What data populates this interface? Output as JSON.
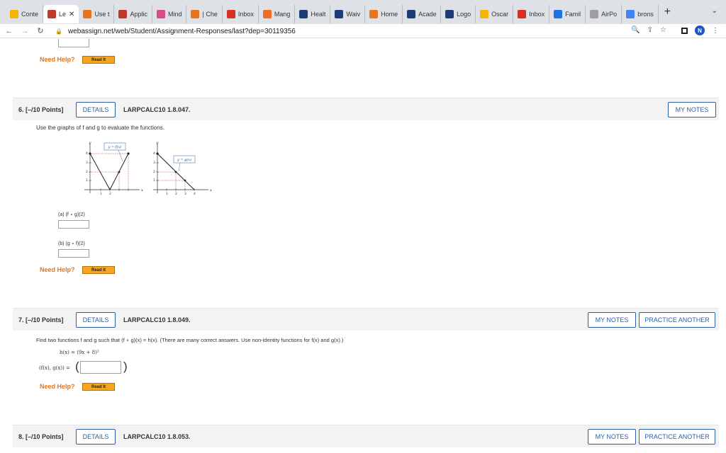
{
  "tabs": [
    {
      "label": "Conte",
      "color": "#f4b400"
    },
    {
      "label": "Le",
      "color": "#c0392b",
      "active": true
    },
    {
      "label": "Use t",
      "color": "#e8741d"
    },
    {
      "label": "Applic",
      "color": "#c0392b"
    },
    {
      "label": "Mind",
      "color": "#d94c8a"
    },
    {
      "label": "| Che",
      "color": "#e8741d"
    },
    {
      "label": "Inbox",
      "color": "#d93025"
    },
    {
      "label": "Mang",
      "color": "#f06b24"
    },
    {
      "label": "Healt",
      "color": "#1c3c7a"
    },
    {
      "label": "Waiv",
      "color": "#1c3c7a"
    },
    {
      "label": "Home",
      "color": "#e8741d"
    },
    {
      "label": "Acade",
      "color": "#1c3c7a"
    },
    {
      "label": "Logo",
      "color": "#1c3c7a"
    },
    {
      "label": "Oscar",
      "color": "#f4b400"
    },
    {
      "label": "Inbox",
      "color": "#d93025"
    },
    {
      "label": "Famil",
      "color": "#1a73e8"
    },
    {
      "label": "AirPo",
      "color": "#9e9e9e"
    },
    {
      "label": "brons",
      "color": "#4285f4"
    }
  ],
  "browser": {
    "url": "webassign.net/web/Student/Assignment-Responses/last?dep=30119356",
    "avatar_letter": "N"
  },
  "help": {
    "need_help": "Need Help?",
    "read_it": "Read It"
  },
  "q6": {
    "number": "6.  [–/10 Points]",
    "details": "DETAILS",
    "code": "LARPCALC10 1.8.047.",
    "my_notes": "MY NOTES",
    "prompt": "Use the graphs of f and g to evaluate the functions.",
    "part_a": "(a)    (f ∘ g)(2)",
    "part_b": "(b)    (g ∘ f)(2)",
    "graph_f_label": "y = f(x)",
    "graph_g_label": "y = g(x)"
  },
  "q7": {
    "number": "7.  [–/10 Points]",
    "details": "DETAILS",
    "code": "LARPCALC10 1.8.049.",
    "my_notes": "MY NOTES",
    "practice": "PRACTICE ANOTHER",
    "prompt": "Find two functions f and g such that (f ∘ g)(x) = h(x). (There are many correct answers. Use non-identity functions for f(x) and g(x).)",
    "h_def": "h(x) = (9x + 8)²",
    "answer_label": "(f(x), g(x)) ="
  },
  "q8": {
    "number": "8.  [–/10 Points]",
    "details": "DETAILS",
    "code": "LARPCALC10 1.8.053.",
    "my_notes": "MY NOTES",
    "practice": "PRACTICE ANOTHER"
  }
}
